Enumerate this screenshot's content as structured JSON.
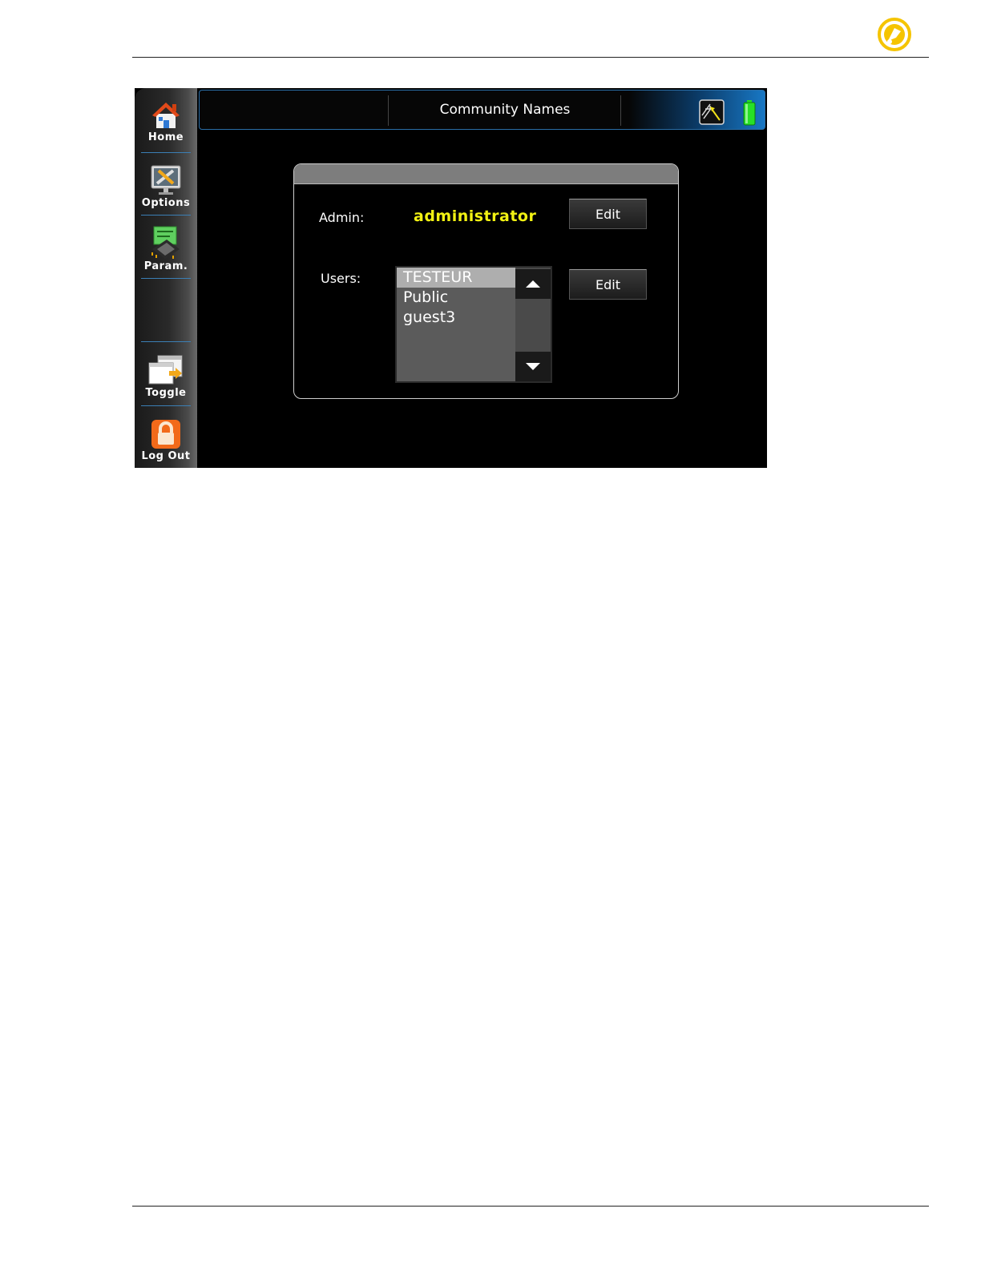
{
  "screen": {
    "title": "Community Names"
  },
  "sidebar": {
    "items": [
      {
        "label": "Home",
        "icon": "home-icon"
      },
      {
        "label": "Options",
        "icon": "options-icon"
      },
      {
        "label": "Param.",
        "icon": "param-icon"
      },
      {
        "label": "Toggle",
        "icon": "toggle-icon"
      },
      {
        "label": "Log Out",
        "icon": "lock-icon"
      }
    ]
  },
  "status": {
    "network_icon": "network-icon",
    "battery_icon": "battery-icon",
    "battery_color": "#27e027"
  },
  "admin": {
    "label": "Admin:",
    "value": "administrator",
    "edit_label": "Edit"
  },
  "users": {
    "label": "Users:",
    "items": [
      "TESTEUR",
      "Public",
      "guest3"
    ],
    "selected": "TESTEUR",
    "edit_label": "Edit"
  },
  "colors": {
    "accent": "#1877c4",
    "admin_value": "#f2f213",
    "brand_logo": "#f5c400"
  }
}
